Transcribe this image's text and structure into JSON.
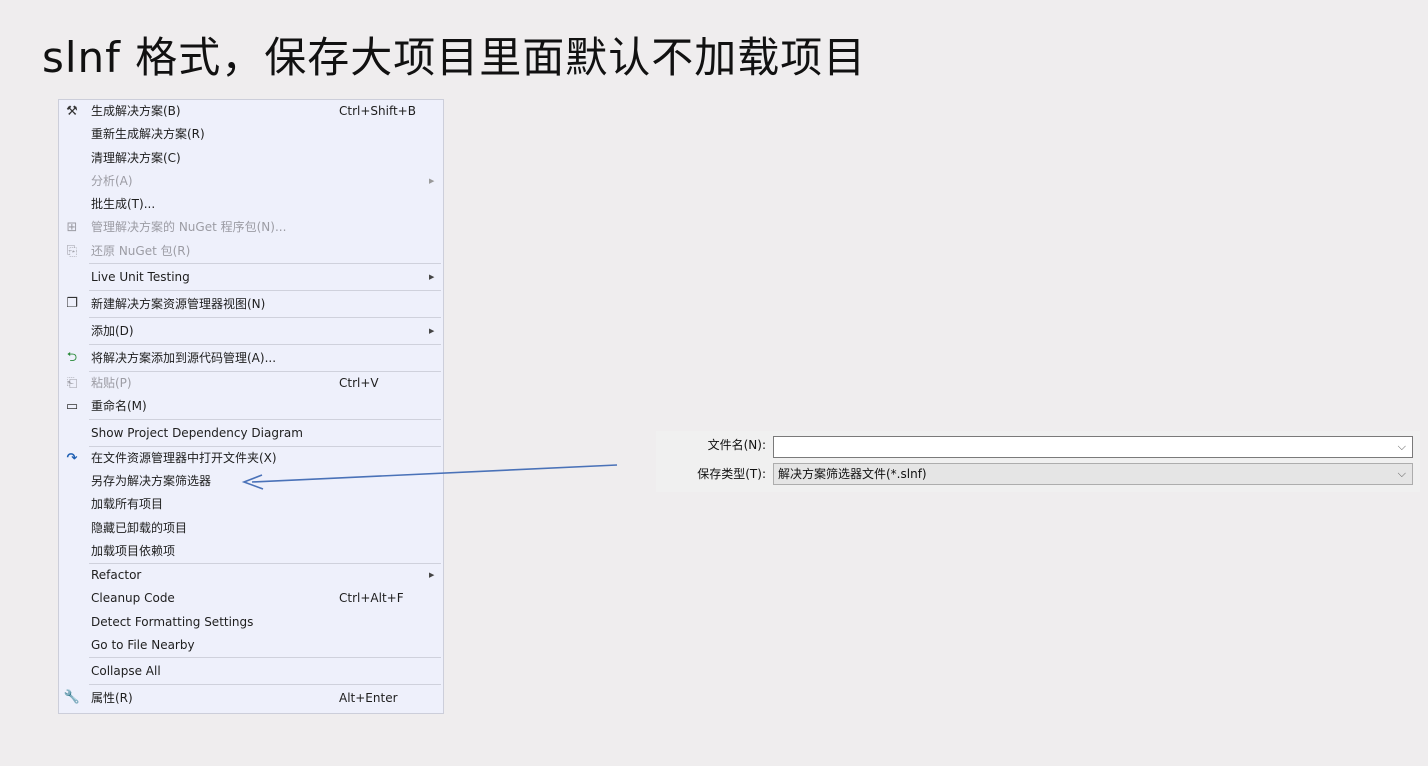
{
  "slide": {
    "title": "slnf 格式，保存大项目里面默认不加载项目"
  },
  "menu": {
    "items": [
      {
        "label": "生成解决方案(B)",
        "shortcut": "Ctrl+Shift+B",
        "icon": "build-icon"
      },
      {
        "label": "重新生成解决方案(R)"
      },
      {
        "label": "清理解决方案(C)"
      },
      {
        "label": "分析(A)",
        "submenu": true,
        "disabled": true
      },
      {
        "label": "批生成(T)..."
      },
      {
        "label": "管理解决方案的 NuGet 程序包(N)...",
        "disabled": true,
        "icon": "nuget-icon"
      },
      {
        "label": "还原 NuGet 包(R)",
        "disabled": true,
        "icon": "restore-icon"
      },
      {
        "label": "Live Unit Testing",
        "submenu": true
      },
      {
        "label": "新建解决方案资源管理器视图(N)",
        "icon": "new-view-icon"
      },
      {
        "label": "添加(D)",
        "submenu": true
      },
      {
        "label": "将解决方案添加到源代码管理(A)...",
        "icon": "source-control-icon"
      },
      {
        "label": "粘贴(P)",
        "shortcut": "Ctrl+V",
        "disabled": true,
        "icon": "paste-icon"
      },
      {
        "label": "重命名(M)",
        "icon": "rename-icon"
      },
      {
        "label": "Show Project Dependency Diagram"
      },
      {
        "label": "在文件资源管理器中打开文件夹(X)",
        "icon": "open-folder-icon"
      },
      {
        "label": "另存为解决方案筛选器"
      },
      {
        "label": "加载所有项目"
      },
      {
        "label": "隐藏已卸载的项目"
      },
      {
        "label": "加载项目依赖项"
      },
      {
        "label": "Refactor",
        "submenu": true
      },
      {
        "label": "Cleanup Code",
        "shortcut": "Ctrl+Alt+F"
      },
      {
        "label": "Detect Formatting Settings"
      },
      {
        "label": "Go to File Nearby"
      },
      {
        "label": "Collapse All"
      },
      {
        "label": "属性(R)",
        "shortcut": "Alt+Enter",
        "icon": "wrench-icon"
      }
    ]
  },
  "dialog": {
    "filename_label": "文件名(N):",
    "filename_value": "",
    "filetype_label": "保存类型(T):",
    "filetype_value": "解决方案筛选器文件(*.slnf)"
  },
  "colors": {
    "menu_bg": "#eef0fb",
    "arrow": "#4a72b8"
  }
}
